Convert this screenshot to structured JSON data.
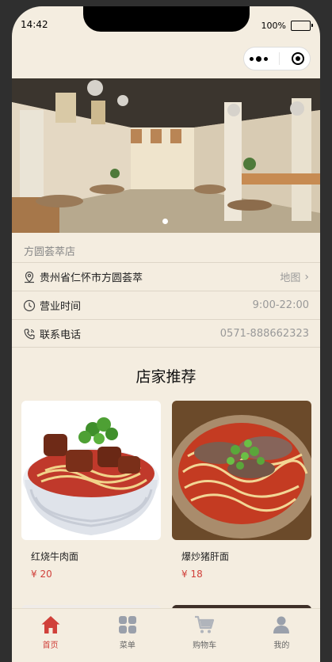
{
  "status_bar": {
    "time": "14:42",
    "battery_text": "100%"
  },
  "capsule": {
    "menu_icon": "more-dots-icon",
    "close_icon": "target-icon"
  },
  "banner": {
    "pager_total": 1,
    "pager_active": 0
  },
  "store": {
    "name": "方圆荟萃店",
    "address_label": "贵州省仁怀市方圆荟萃",
    "address_action": "地图",
    "hours_label": "营业时间",
    "hours_value": "9:00-22:00",
    "phone_label": "联系电话",
    "phone_value": "0571-888662323"
  },
  "recommend": {
    "title": "店家推荐",
    "items": [
      {
        "name": "红烧牛肉面",
        "price": "¥ 20"
      },
      {
        "name": "爆炒猪肝面",
        "price": "¥ 18"
      }
    ]
  },
  "tabbar": {
    "items": [
      {
        "label": "首页",
        "icon": "home-icon",
        "active": true
      },
      {
        "label": "菜单",
        "icon": "grid-icon",
        "active": false
      },
      {
        "label": "购物车",
        "icon": "cart-icon",
        "active": false
      },
      {
        "label": "我的",
        "icon": "user-icon",
        "active": false
      }
    ]
  },
  "colors": {
    "background": "#f4ede0",
    "accent": "#d0403a"
  }
}
